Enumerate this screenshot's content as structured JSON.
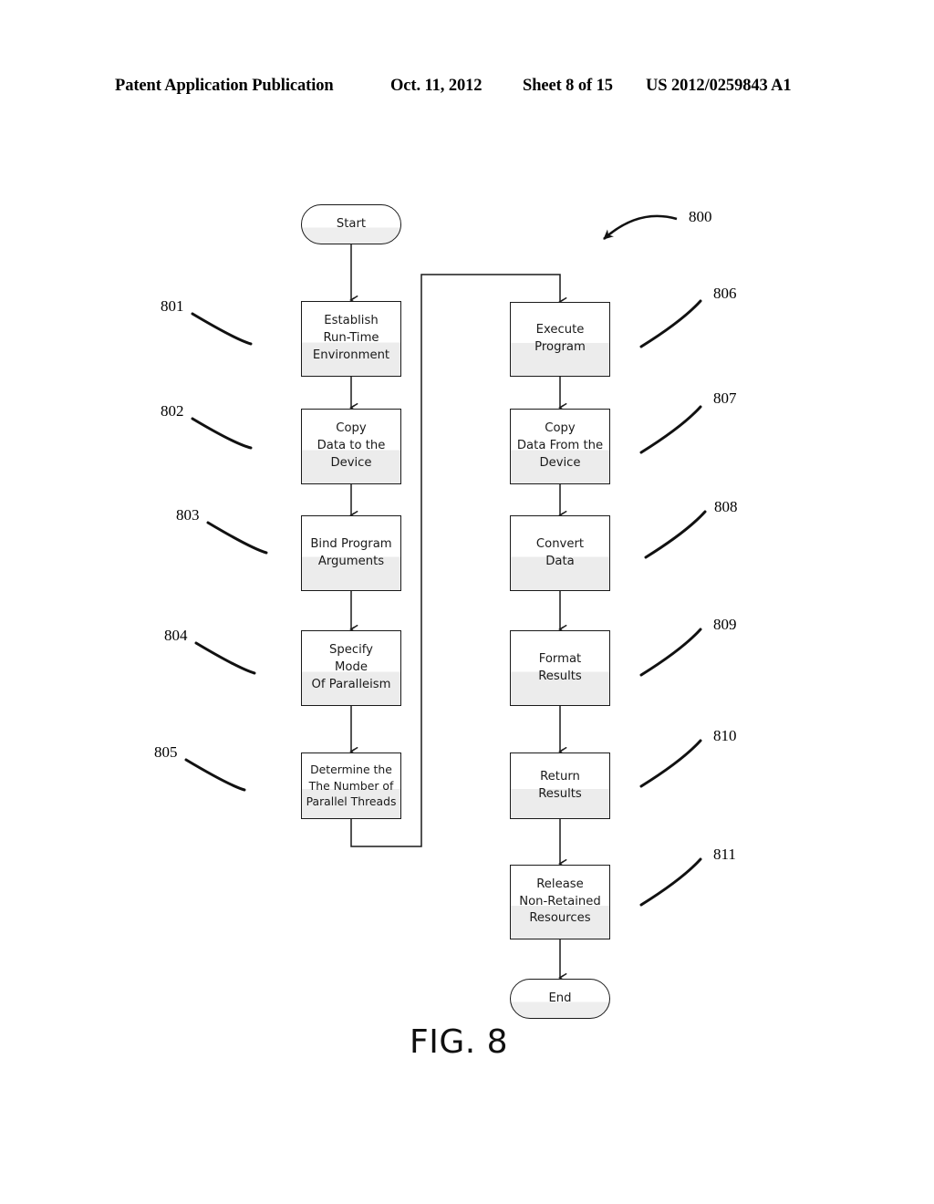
{
  "header": {
    "publication": "Patent Application Publication",
    "date": "Oct. 11, 2012",
    "sheet": "Sheet 8 of 15",
    "number": "US 2012/0259843 A1"
  },
  "figure": {
    "caption": "FIG. 8",
    "overall_ref": "800"
  },
  "nodes": {
    "start": {
      "label": "Start"
    },
    "end": {
      "label": "End"
    },
    "left_column": [
      {
        "ref": "801",
        "label": "Establish\nRun-Time\nEnvironment"
      },
      {
        "ref": "802",
        "label": "Copy\nData to the\nDevice"
      },
      {
        "ref": "803",
        "label": "Bind  Program\nArguments"
      },
      {
        "ref": "804",
        "label": "Specify\nMode\nOf Paralleism"
      },
      {
        "ref": "805",
        "label": "Determine the\nThe Number of\nParallel  Threads"
      }
    ],
    "right_column": [
      {
        "ref": "806",
        "label": "Execute\nProgram"
      },
      {
        "ref": "807",
        "label": "Copy\nData From the\nDevice"
      },
      {
        "ref": "808",
        "label": "Convert\nData"
      },
      {
        "ref": "809",
        "label": "Format\nResults"
      },
      {
        "ref": "810",
        "label": "Return\nResults"
      },
      {
        "ref": "811",
        "label": "Release\nNon-Retained\nResources"
      }
    ]
  },
  "colors": {
    "stroke": "#1a1a1a",
    "box_fill_top": "#ffffff",
    "box_fill_bottom": "#ececec",
    "background": "#ffffff"
  }
}
